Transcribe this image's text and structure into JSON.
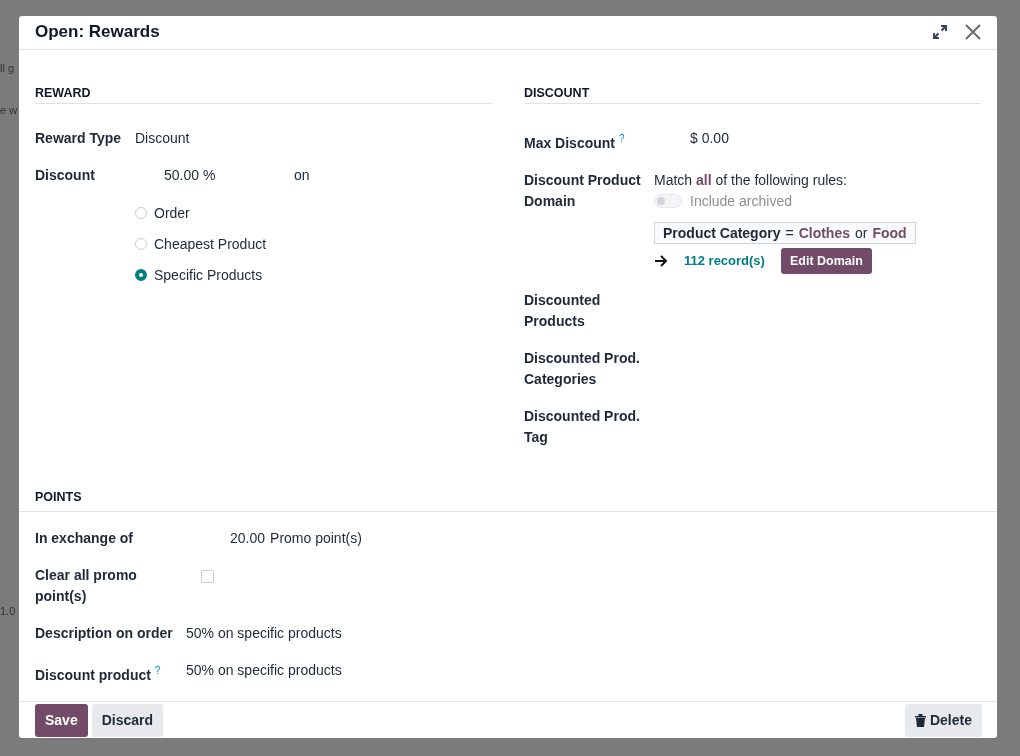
{
  "background": {
    "fragments": [
      "ll g",
      "e w",
      "1.0"
    ]
  },
  "window": {
    "title": "Open: Rewards"
  },
  "reward": {
    "heading": "REWARD",
    "reward_type": {
      "label": "Reward Type",
      "value": "Discount"
    },
    "discount": {
      "label": "Discount",
      "value": "50.00 %",
      "suffix": "on"
    },
    "options": [
      {
        "label": "Order",
        "selected": false
      },
      {
        "label": "Cheapest Product",
        "selected": false
      },
      {
        "label": "Specific Products",
        "selected": true
      }
    ]
  },
  "discount": {
    "heading": "DISCOUNT",
    "max_discount": {
      "label": "Max Discount",
      "help": "?",
      "value": "$ 0.00"
    },
    "domain": {
      "label": "Discount Product Domain",
      "match": "Match **all** of the following rules:",
      "include_archived": {
        "label": "Include archived",
        "on": false
      },
      "rule": {
        "field": "Product Category",
        "operator": "=",
        "values": [
          "Clothes",
          "Food"
        ],
        "joiner": "or"
      },
      "records": "112 record(s)",
      "edit_button": "Edit Domain"
    },
    "fields": [
      "Discounted Products",
      "Discounted Prod. Categories",
      "Discounted Prod. Tag"
    ]
  },
  "points": {
    "heading": "POINTS",
    "in_exchange": {
      "label": "In exchange of",
      "amount": "20.00",
      "unit": "Promo point(s)"
    },
    "clear_all": {
      "label": "Clear all promo point(s)",
      "checked": false
    },
    "description": {
      "label": "Description on order",
      "value": "50% on specific products"
    },
    "discount_product": {
      "label": "Discount product",
      "help": "?",
      "value": "50% on specific products"
    }
  },
  "footer": {
    "save": "Save",
    "discard": "Discard",
    "delete": "Delete"
  }
}
